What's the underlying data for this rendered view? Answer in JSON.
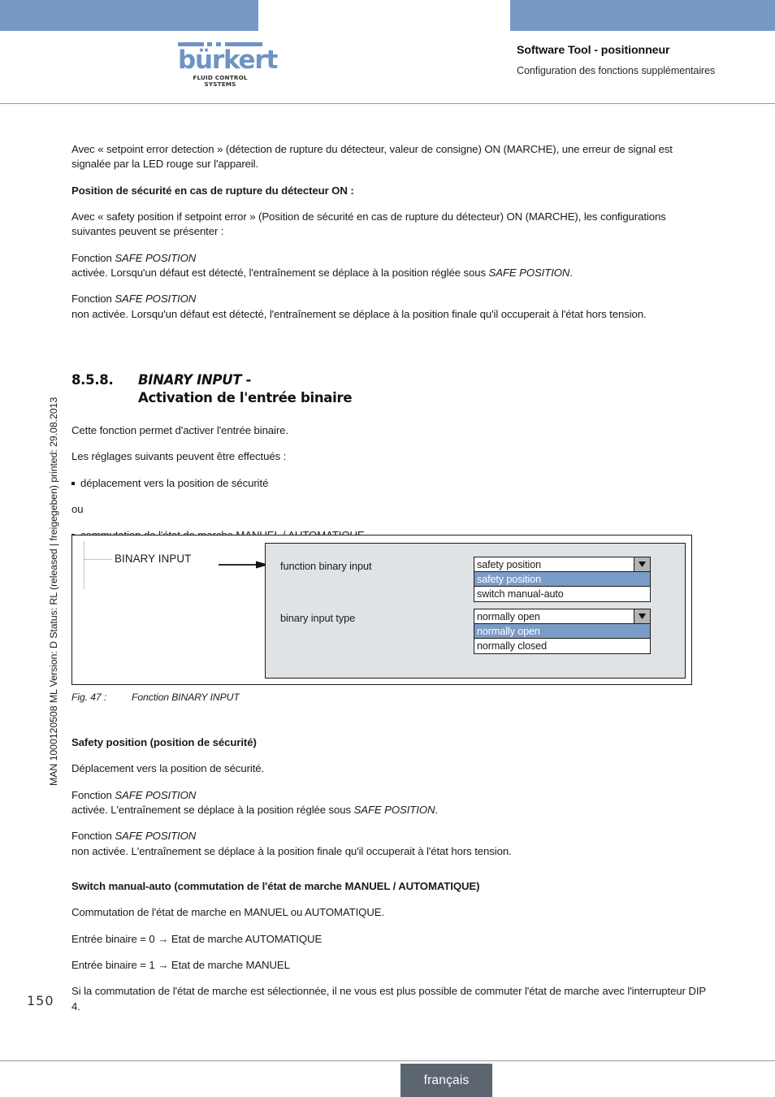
{
  "header": {
    "logo_word": "bürkert",
    "logo_tagline": "FLUID CONTROL SYSTEMS",
    "title": "Software Tool - positionneur",
    "subtitle": "Configuration des fonctions supplémentaires",
    "bar_color": "#7799c6",
    "logo_color": "#6e93c4"
  },
  "side_note": "MAN 1000120508  ML  Version: D  Status: RL (released | freigegeben)  printed: 29.08.2013",
  "body": {
    "p1_a": "Avec « setpoint error detection » (détection de rupture du détecteur, valeur de consigne) ON (MARCHE), une erreur de signal est signalée par la LED rouge sur l'appareil.",
    "h1": "Position de sécurité en cas de rupture du détecteur ON :",
    "p2": "Avec « safety position if setpoint error » (Position de sécurité en cas de rupture du détecteur) ON (MARCHE), les configurations suivantes peuvent se présenter :",
    "p3_pre": "Fonction ",
    "p3_it1": "SAFE POSITION",
    "p3_mid": " activée. Lorsqu'un défaut est détecté, l'entraînement se déplace à la position réglée sous ",
    "p3_it2": "SAFE POSITION",
    "p3_end": ".",
    "p4_pre": "Fonction ",
    "p4_it1": "SAFE POSITION",
    "p4_mid": " non activée. Lorsqu'un défaut est détecté, l'entraînement se déplace à la position finale qu'il occuperait à l'état hors tension."
  },
  "section": {
    "number": "8.5.8.",
    "title_line1": "BINARY INPUT -",
    "title_line2": "Activation de l'entrée binaire"
  },
  "intro": {
    "p1": "Cette fonction permet d'activer l'entrée binaire.",
    "p2": "Les réglages suivants peuvent être effectués :",
    "b1": "déplacement vers la position de sécurité",
    "or": "ou",
    "b2": "commutation de l'état de marche MANUEL / AUTOMATIQUE"
  },
  "figure": {
    "leader_label": "BINARY INPUT",
    "caption_num": "Fig. 47 :",
    "caption_text": "Fonction BINARY INPUT",
    "dialog": {
      "panel_color": "#dfe3e6",
      "highlight_color": "#7b9cc7",
      "fields": [
        {
          "label": "function binary input",
          "value": "safety position",
          "arrow_glyph": "▼",
          "options": [
            {
              "label": "safety position",
              "selected": true
            },
            {
              "label": "switch manual-auto",
              "selected": false
            }
          ]
        },
        {
          "label": "binary input type",
          "value": "normally open",
          "arrow_glyph": "▼",
          "options": [
            {
              "label": "normally open",
              "selected": true
            },
            {
              "label": "normally closed",
              "selected": false
            }
          ]
        }
      ]
    }
  },
  "lower": {
    "h1": "Safety position (position de sécurité)",
    "p1": "Déplacement vers la position de sécurité.",
    "p2_pre": "Fonction ",
    "p2_it1": "SAFE POSITION",
    "p2_mid": "activée. L'entraînement se déplace à la position réglée sous ",
    "p2_it2": "SAFE POSITION",
    "p2_end": ".",
    "p3_pre": "Fonction ",
    "p3_it1": "SAFE POSITION",
    "p3_mid": "non activée. L'entraînement se déplace à la position finale qu'il occuperait à l'état hors tension."
  },
  "lower2": {
    "h1": "Switch manual-auto (commutation de l'état de marche MANUEL / AUTOMATIQUE)",
    "p1": "Commutation de l'état de marche en MANUEL ou AUTOMATIQUE.",
    "p2": "Entrée binaire = 0 → Etat de marche AUTOMATIQUE",
    "p3": "Entrée binaire = 1 → Etat de marche MANUEL",
    "p4": "Si la commutation de l'état de marche est sélectionnée, il ne vous est plus possible de commuter l'état de marche avec l'interrupteur DIP 4."
  },
  "footer": {
    "page_number": "150",
    "language": "français",
    "box_color": "#5c6670"
  }
}
